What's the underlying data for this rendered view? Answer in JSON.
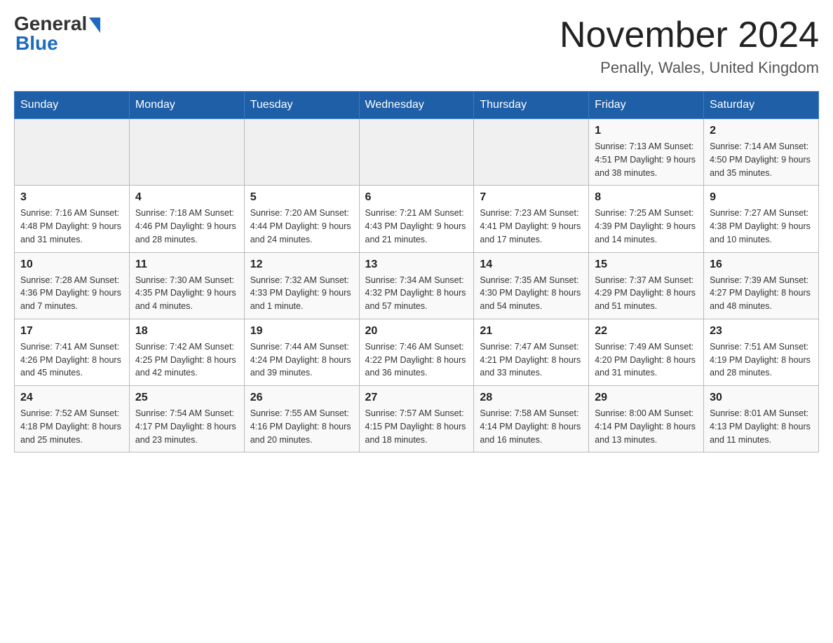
{
  "logo": {
    "general": "General",
    "blue": "Blue"
  },
  "header": {
    "title": "November 2024",
    "location": "Penally, Wales, United Kingdom"
  },
  "days_of_week": [
    "Sunday",
    "Monday",
    "Tuesday",
    "Wednesday",
    "Thursday",
    "Friday",
    "Saturday"
  ],
  "weeks": [
    [
      {
        "day": "",
        "info": ""
      },
      {
        "day": "",
        "info": ""
      },
      {
        "day": "",
        "info": ""
      },
      {
        "day": "",
        "info": ""
      },
      {
        "day": "",
        "info": ""
      },
      {
        "day": "1",
        "info": "Sunrise: 7:13 AM\nSunset: 4:51 PM\nDaylight: 9 hours and 38 minutes."
      },
      {
        "day": "2",
        "info": "Sunrise: 7:14 AM\nSunset: 4:50 PM\nDaylight: 9 hours and 35 minutes."
      }
    ],
    [
      {
        "day": "3",
        "info": "Sunrise: 7:16 AM\nSunset: 4:48 PM\nDaylight: 9 hours and 31 minutes."
      },
      {
        "day": "4",
        "info": "Sunrise: 7:18 AM\nSunset: 4:46 PM\nDaylight: 9 hours and 28 minutes."
      },
      {
        "day": "5",
        "info": "Sunrise: 7:20 AM\nSunset: 4:44 PM\nDaylight: 9 hours and 24 minutes."
      },
      {
        "day": "6",
        "info": "Sunrise: 7:21 AM\nSunset: 4:43 PM\nDaylight: 9 hours and 21 minutes."
      },
      {
        "day": "7",
        "info": "Sunrise: 7:23 AM\nSunset: 4:41 PM\nDaylight: 9 hours and 17 minutes."
      },
      {
        "day": "8",
        "info": "Sunrise: 7:25 AM\nSunset: 4:39 PM\nDaylight: 9 hours and 14 minutes."
      },
      {
        "day": "9",
        "info": "Sunrise: 7:27 AM\nSunset: 4:38 PM\nDaylight: 9 hours and 10 minutes."
      }
    ],
    [
      {
        "day": "10",
        "info": "Sunrise: 7:28 AM\nSunset: 4:36 PM\nDaylight: 9 hours and 7 minutes."
      },
      {
        "day": "11",
        "info": "Sunrise: 7:30 AM\nSunset: 4:35 PM\nDaylight: 9 hours and 4 minutes."
      },
      {
        "day": "12",
        "info": "Sunrise: 7:32 AM\nSunset: 4:33 PM\nDaylight: 9 hours and 1 minute."
      },
      {
        "day": "13",
        "info": "Sunrise: 7:34 AM\nSunset: 4:32 PM\nDaylight: 8 hours and 57 minutes."
      },
      {
        "day": "14",
        "info": "Sunrise: 7:35 AM\nSunset: 4:30 PM\nDaylight: 8 hours and 54 minutes."
      },
      {
        "day": "15",
        "info": "Sunrise: 7:37 AM\nSunset: 4:29 PM\nDaylight: 8 hours and 51 minutes."
      },
      {
        "day": "16",
        "info": "Sunrise: 7:39 AM\nSunset: 4:27 PM\nDaylight: 8 hours and 48 minutes."
      }
    ],
    [
      {
        "day": "17",
        "info": "Sunrise: 7:41 AM\nSunset: 4:26 PM\nDaylight: 8 hours and 45 minutes."
      },
      {
        "day": "18",
        "info": "Sunrise: 7:42 AM\nSunset: 4:25 PM\nDaylight: 8 hours and 42 minutes."
      },
      {
        "day": "19",
        "info": "Sunrise: 7:44 AM\nSunset: 4:24 PM\nDaylight: 8 hours and 39 minutes."
      },
      {
        "day": "20",
        "info": "Sunrise: 7:46 AM\nSunset: 4:22 PM\nDaylight: 8 hours and 36 minutes."
      },
      {
        "day": "21",
        "info": "Sunrise: 7:47 AM\nSunset: 4:21 PM\nDaylight: 8 hours and 33 minutes."
      },
      {
        "day": "22",
        "info": "Sunrise: 7:49 AM\nSunset: 4:20 PM\nDaylight: 8 hours and 31 minutes."
      },
      {
        "day": "23",
        "info": "Sunrise: 7:51 AM\nSunset: 4:19 PM\nDaylight: 8 hours and 28 minutes."
      }
    ],
    [
      {
        "day": "24",
        "info": "Sunrise: 7:52 AM\nSunset: 4:18 PM\nDaylight: 8 hours and 25 minutes."
      },
      {
        "day": "25",
        "info": "Sunrise: 7:54 AM\nSunset: 4:17 PM\nDaylight: 8 hours and 23 minutes."
      },
      {
        "day": "26",
        "info": "Sunrise: 7:55 AM\nSunset: 4:16 PM\nDaylight: 8 hours and 20 minutes."
      },
      {
        "day": "27",
        "info": "Sunrise: 7:57 AM\nSunset: 4:15 PM\nDaylight: 8 hours and 18 minutes."
      },
      {
        "day": "28",
        "info": "Sunrise: 7:58 AM\nSunset: 4:14 PM\nDaylight: 8 hours and 16 minutes."
      },
      {
        "day": "29",
        "info": "Sunrise: 8:00 AM\nSunset: 4:14 PM\nDaylight: 8 hours and 13 minutes."
      },
      {
        "day": "30",
        "info": "Sunrise: 8:01 AM\nSunset: 4:13 PM\nDaylight: 8 hours and 11 minutes."
      }
    ]
  ]
}
